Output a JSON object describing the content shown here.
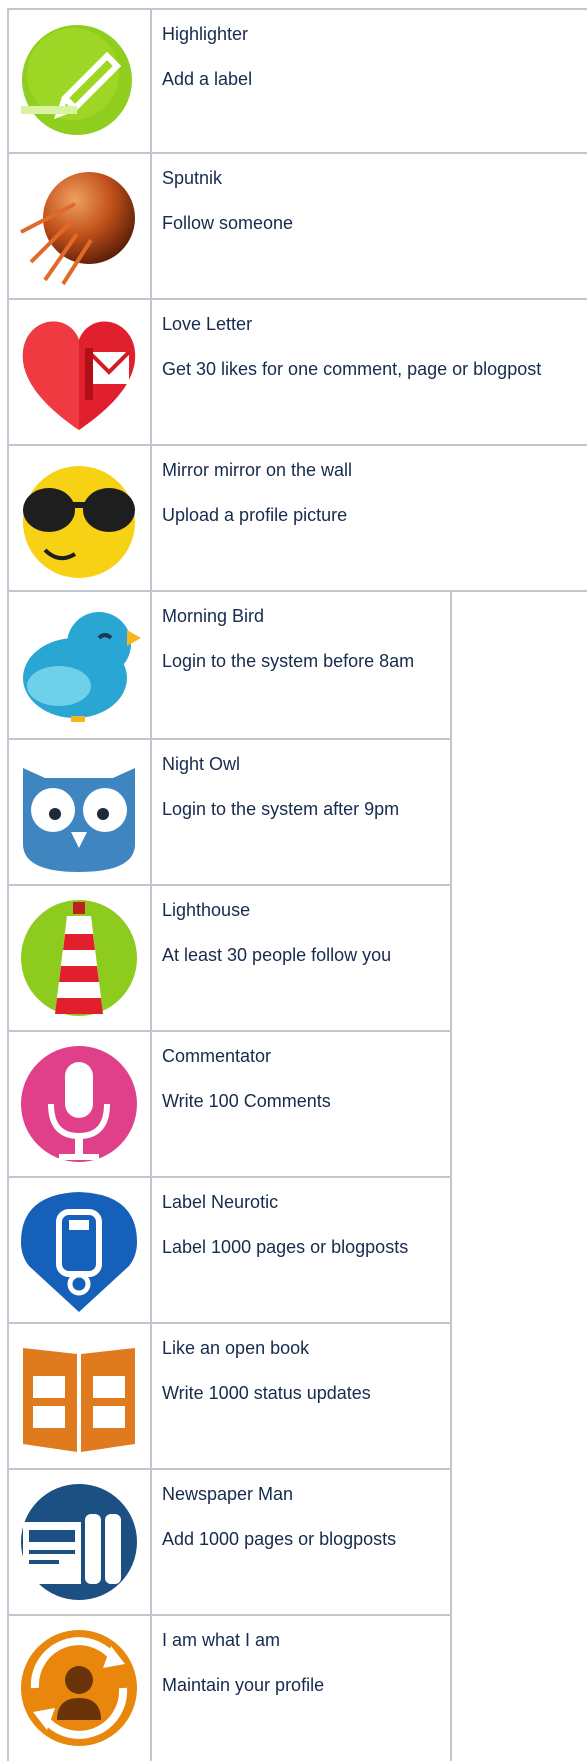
{
  "badges": [
    {
      "title": "Highlighter",
      "description": "Add a label",
      "icon": "highlighter-icon"
    },
    {
      "title": "Sputnik",
      "description": "Follow someone",
      "icon": "sputnik-icon"
    },
    {
      "title": "Love Letter",
      "description": "Get 30 likes for one comment, page or blogpost",
      "icon": "love-letter-icon"
    },
    {
      "title": "Mirror mirror on the wall",
      "description": "Upload a profile picture",
      "icon": "sunglasses-smiley-icon"
    },
    {
      "title": "Morning Bird",
      "description": "Login to the system before 8am",
      "icon": "bird-icon"
    },
    {
      "title": "Night Owl",
      "description": "Login to the system after 9pm",
      "icon": "owl-icon"
    },
    {
      "title": "Lighthouse",
      "description": "At least 30 people follow you",
      "icon": "lighthouse-icon"
    },
    {
      "title": "Commentator",
      "description": "Write 100 Comments",
      "icon": "microphone-icon"
    },
    {
      "title": "Label Neurotic",
      "description": "Label 1000 pages or blogposts",
      "icon": "label-tag-icon"
    },
    {
      "title": "Like an open book",
      "description": "Write 1000 status updates",
      "icon": "open-book-icon"
    },
    {
      "title": "Newspaper Man",
      "description": "Add 1000 pages or blogposts",
      "icon": "newspaper-icon"
    },
    {
      "title": "I am what I am",
      "description": "Maintain your profile",
      "icon": "profile-sync-icon"
    }
  ]
}
